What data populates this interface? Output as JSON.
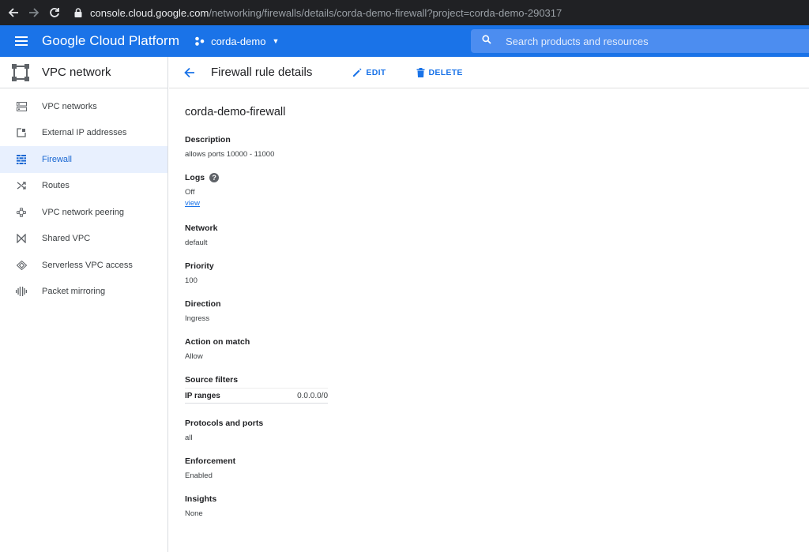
{
  "browser": {
    "url_domain": "console.cloud.google.com",
    "url_path": "/networking/firewalls/details/corda-demo-firewall?project=corda-demo-290317"
  },
  "header": {
    "brand": "Google Cloud Platform",
    "project": "corda-demo",
    "search_placeholder": "Search products and resources",
    "color": "#1a73e8"
  },
  "sidebar": {
    "title": "VPC network",
    "items": [
      {
        "label": "VPC networks",
        "icon": "vpc-networks-icon",
        "active": false
      },
      {
        "label": "External IP addresses",
        "icon": "external-ip-icon",
        "active": false
      },
      {
        "label": "Firewall",
        "icon": "firewall-icon",
        "active": true
      },
      {
        "label": "Routes",
        "icon": "routes-icon",
        "active": false
      },
      {
        "label": "VPC network peering",
        "icon": "peering-icon",
        "active": false
      },
      {
        "label": "Shared VPC",
        "icon": "shared-vpc-icon",
        "active": false
      },
      {
        "label": "Serverless VPC access",
        "icon": "serverless-vpc-icon",
        "active": false
      },
      {
        "label": "Packet mirroring",
        "icon": "packet-mirroring-icon",
        "active": false
      }
    ]
  },
  "toolbar": {
    "title": "Firewall rule details",
    "edit_label": "EDIT",
    "delete_label": "DELETE"
  },
  "rule": {
    "name": "corda-demo-firewall",
    "description_label": "Description",
    "description": "allows ports 10000 - 11000",
    "logs_label": "Logs",
    "logs": "Off",
    "logs_link": "view",
    "network_label": "Network",
    "network": "default",
    "priority_label": "Priority",
    "priority": "100",
    "direction_label": "Direction",
    "direction": "Ingress",
    "action_label": "Action on match",
    "action": "Allow",
    "source_filters_label": "Source filters",
    "ip_ranges_label": "IP ranges",
    "ip_ranges": "0.0.0.0/0",
    "protocols_label": "Protocols and ports",
    "protocols": "all",
    "enforcement_label": "Enforcement",
    "enforcement": "Enabled",
    "insights_label": "Insights",
    "insights": "None"
  }
}
